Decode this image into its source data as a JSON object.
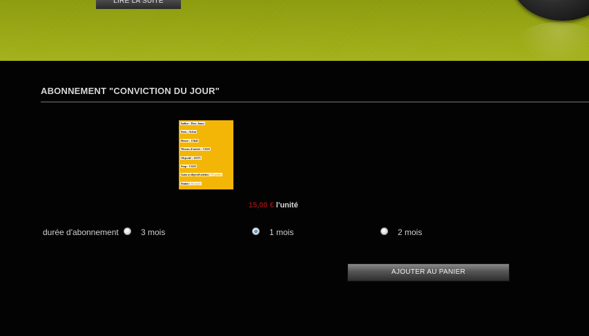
{
  "banner": {
    "read_more_label": "LIRE LA SUITE"
  },
  "product": {
    "title": "ABONNEMENT \"CONVICTION DU JOUR\"",
    "thumbnail": {
      "lines": [
        {
          "label": "Indice : ",
          "value": "Dow Jones"
        },
        {
          "label": "Sens : ",
          "value": "Achat"
        },
        {
          "label": "Heure : ",
          "value": "15h45"
        },
        {
          "label": "Niveau d'entrée : ",
          "value": "13525"
        },
        {
          "label": "Objectif : ",
          "value": "13575"
        },
        {
          "label": "Stop : ",
          "value": "13225"
        },
        {
          "label": "Gain si objectif atteint : ",
          "value": "50 points"
        },
        {
          "label": "Statut : ",
          "value": "en cours"
        }
      ]
    },
    "price": {
      "value": "15,00 €",
      "unit": "l'unité"
    }
  },
  "subscription": {
    "label": "durée d'abonnement",
    "options": [
      {
        "label": "3 mois",
        "checked": false
      },
      {
        "label": "1 mois",
        "checked": true
      },
      {
        "label": "2 mois",
        "checked": false
      }
    ]
  },
  "cart": {
    "add_label": "AJOUTER AU PANIER"
  },
  "colors": {
    "banner": "#93a10e",
    "price": "#8f1010",
    "thumbnail": "#f4b606"
  }
}
